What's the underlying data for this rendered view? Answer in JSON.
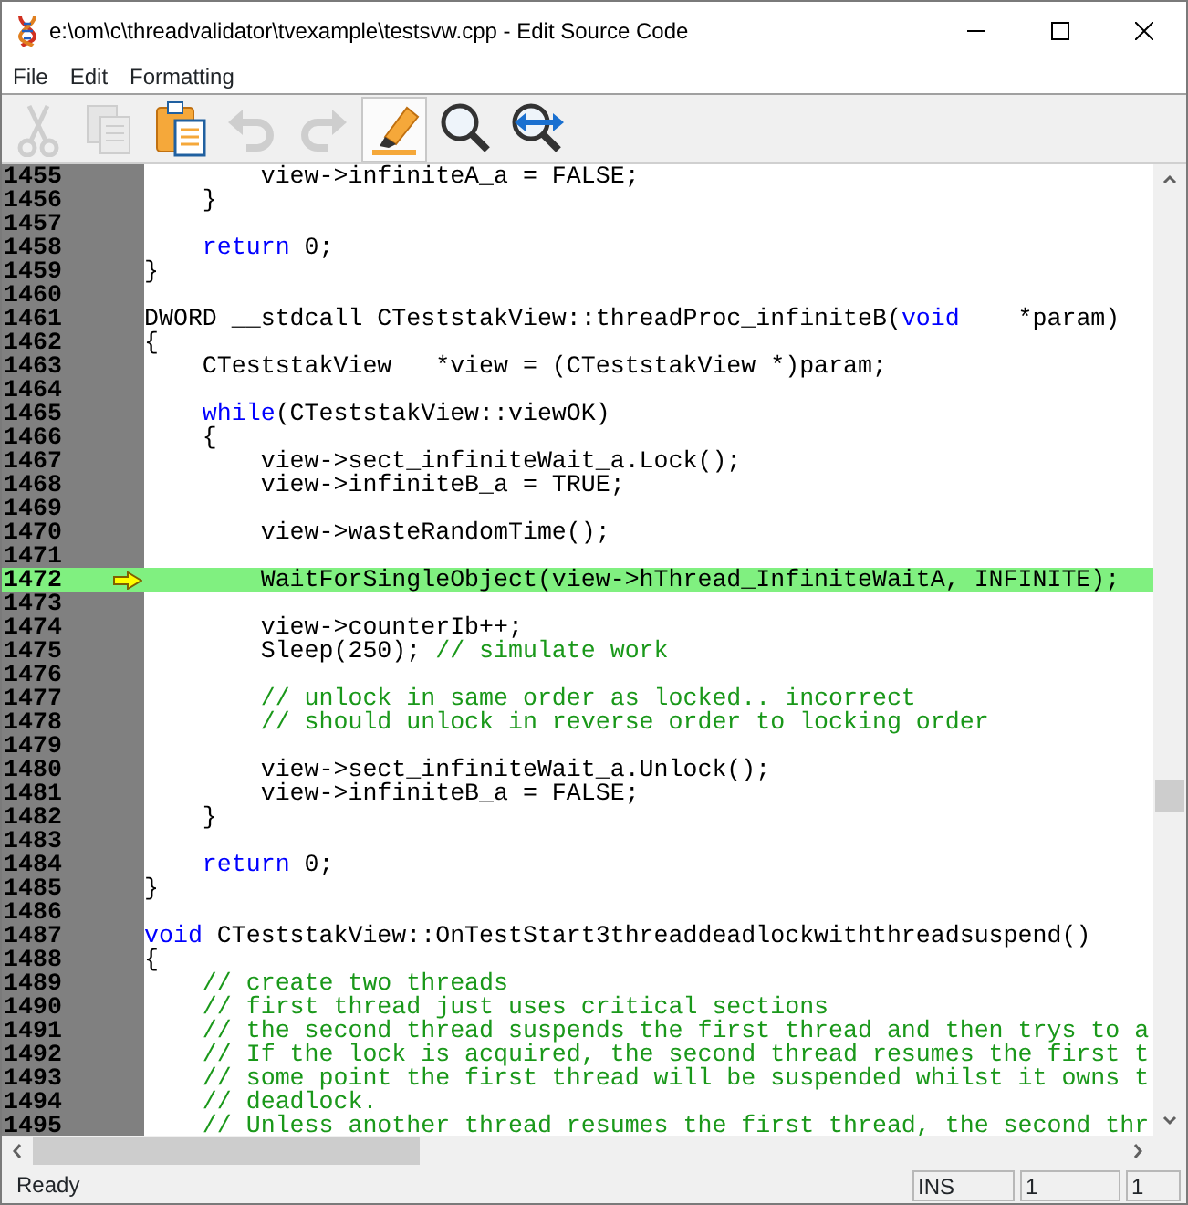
{
  "window": {
    "title": "e:\\om\\c\\threadvalidator\\tvexample\\testsvw.cpp - Edit Source Code"
  },
  "menu": [
    "File",
    "Edit",
    "Formatting"
  ],
  "toolbar": [
    {
      "kind": "cut",
      "disabled": true,
      "selected": false
    },
    {
      "kind": "copy",
      "disabled": true,
      "selected": false
    },
    {
      "kind": "paste",
      "disabled": false,
      "selected": false
    },
    {
      "kind": "undo",
      "disabled": true,
      "selected": false
    },
    {
      "kind": "redo",
      "disabled": true,
      "selected": false
    },
    {
      "kind": "highlight",
      "disabled": false,
      "selected": true
    },
    {
      "kind": "find",
      "disabled": false,
      "selected": false
    },
    {
      "kind": "goto",
      "disabled": false,
      "selected": false
    }
  ],
  "editor": {
    "lines": [
      {
        "number": "1455",
        "current": false,
        "segments": [
          {
            "kind": "plain",
            "text": "        view->infiniteA_a = FALSE;"
          }
        ]
      },
      {
        "number": "1456",
        "current": false,
        "segments": [
          {
            "kind": "plain",
            "text": "    }"
          }
        ]
      },
      {
        "number": "1457",
        "current": false
      },
      {
        "number": "1458",
        "current": false,
        "segments": [
          {
            "kind": "keyword",
            "text": "    return"
          },
          {
            "kind": "plain",
            "text": " 0;"
          }
        ]
      },
      {
        "number": "1459",
        "current": false,
        "segments": [
          {
            "kind": "plain",
            "text": "}"
          }
        ]
      },
      {
        "number": "1460",
        "current": false
      },
      {
        "number": "1461",
        "current": false,
        "segments": [
          {
            "kind": "plain",
            "text": "DWORD __stdcall CTeststakView::threadProc_infiniteB("
          },
          {
            "kind": "keyword",
            "text": "void"
          },
          {
            "kind": "plain",
            "text": "    *param)"
          }
        ]
      },
      {
        "number": "1462",
        "current": false,
        "segments": [
          {
            "kind": "plain",
            "text": "{"
          }
        ]
      },
      {
        "number": "1463",
        "current": false,
        "segments": [
          {
            "kind": "plain",
            "text": "    CTeststakView   *view = (CTeststakView *)param;"
          }
        ]
      },
      {
        "number": "1464",
        "current": false
      },
      {
        "number": "1465",
        "current": false,
        "segments": [
          {
            "kind": "keyword",
            "text": "    while"
          },
          {
            "kind": "plain",
            "text": "(CTeststakView::viewOK)"
          }
        ]
      },
      {
        "number": "1466",
        "current": false,
        "segments": [
          {
            "kind": "plain",
            "text": "    {"
          }
        ]
      },
      {
        "number": "1467",
        "current": false,
        "segments": [
          {
            "kind": "plain",
            "text": "        view->sect_infiniteWait_a.Lock();"
          }
        ]
      },
      {
        "number": "1468",
        "current": false,
        "segments": [
          {
            "kind": "plain",
            "text": "        view->infiniteB_a = TRUE;"
          }
        ]
      },
      {
        "number": "1469",
        "current": false
      },
      {
        "number": "1470",
        "current": false,
        "segments": [
          {
            "kind": "plain",
            "text": "        view->wasteRandomTime();"
          }
        ]
      },
      {
        "number": "1471",
        "current": false
      },
      {
        "number": "1472",
        "current": true,
        "segments": [
          {
            "kind": "plain",
            "text": "        WaitForSingleObject(view->hThread_InfiniteWaitA, INFINITE);"
          }
        ]
      },
      {
        "number": "1473",
        "current": false
      },
      {
        "number": "1474",
        "current": false,
        "segments": [
          {
            "kind": "plain",
            "text": "        view->counterIb++;"
          }
        ]
      },
      {
        "number": "1475",
        "current": false,
        "segments": [
          {
            "kind": "plain",
            "text": "        Sleep(250); "
          },
          {
            "kind": "comment",
            "text": "// simulate work"
          }
        ]
      },
      {
        "number": "1476",
        "current": false
      },
      {
        "number": "1477",
        "current": false,
        "segments": [
          {
            "kind": "comment",
            "text": "        // unlock in same order as locked.. incorrect"
          }
        ]
      },
      {
        "number": "1478",
        "current": false,
        "segments": [
          {
            "kind": "comment",
            "text": "        // should unlock in reverse order to locking order"
          }
        ]
      },
      {
        "number": "1479",
        "current": false
      },
      {
        "number": "1480",
        "current": false,
        "segments": [
          {
            "kind": "plain",
            "text": "        view->sect_infiniteWait_a.Unlock();"
          }
        ]
      },
      {
        "number": "1481",
        "current": false,
        "segments": [
          {
            "kind": "plain",
            "text": "        view->infiniteB_a = FALSE;"
          }
        ]
      },
      {
        "number": "1482",
        "current": false,
        "segments": [
          {
            "kind": "plain",
            "text": "    }"
          }
        ]
      },
      {
        "number": "1483",
        "current": false
      },
      {
        "number": "1484",
        "current": false,
        "segments": [
          {
            "kind": "keyword",
            "text": "    return"
          },
          {
            "kind": "plain",
            "text": " 0;"
          }
        ]
      },
      {
        "number": "1485",
        "current": false,
        "segments": [
          {
            "kind": "plain",
            "text": "}"
          }
        ]
      },
      {
        "number": "1486",
        "current": false
      },
      {
        "number": "1487",
        "current": false,
        "segments": [
          {
            "kind": "keyword",
            "text": "void"
          },
          {
            "kind": "plain",
            "text": " CTeststakView::OnTestStart3threaddeadlockwiththreadsuspend()"
          }
        ]
      },
      {
        "number": "1488",
        "current": false,
        "segments": [
          {
            "kind": "plain",
            "text": "{"
          }
        ]
      },
      {
        "number": "1489",
        "current": false,
        "segments": [
          {
            "kind": "comment",
            "text": "    // create two threads"
          }
        ]
      },
      {
        "number": "1490",
        "current": false,
        "segments": [
          {
            "kind": "comment",
            "text": "    // first thread just uses critical sections"
          }
        ]
      },
      {
        "number": "1491",
        "current": false,
        "segments": [
          {
            "kind": "comment",
            "text": "    // the second thread suspends the first thread and then trys to a"
          }
        ]
      },
      {
        "number": "1492",
        "current": false,
        "segments": [
          {
            "kind": "comment",
            "text": "    // If the lock is acquired, the second thread resumes the first t"
          }
        ]
      },
      {
        "number": "1493",
        "current": false,
        "segments": [
          {
            "kind": "comment",
            "text": "    // some point the first thread will be suspended whilst it owns t"
          }
        ]
      },
      {
        "number": "1494",
        "current": false,
        "segments": [
          {
            "kind": "comment",
            "text": "    // deadlock."
          }
        ]
      },
      {
        "number": "1495",
        "current": false,
        "segments": [
          {
            "kind": "comment",
            "text": "    // Unless another thread resumes the first thread, the second thr"
          }
        ]
      }
    ]
  },
  "status_bar": {
    "message": "Ready",
    "mode": "INS",
    "line": "1",
    "column": "1"
  }
}
